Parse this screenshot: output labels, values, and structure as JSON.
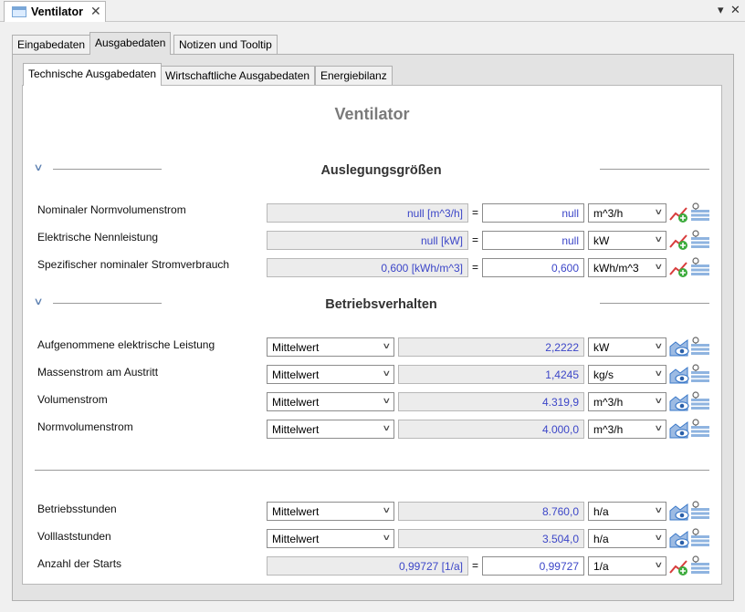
{
  "window": {
    "title": "Ventilator"
  },
  "outer_tabs": [
    {
      "label": "Eingabedaten"
    },
    {
      "label": "Ausgabedaten"
    },
    {
      "label": "Notizen und Tooltip"
    }
  ],
  "inner_tabs": [
    {
      "label": "Technische Ausgabedaten"
    },
    {
      "label": "Wirtschaftliche Ausgabedaten"
    },
    {
      "label": "Energiebilanz"
    }
  ],
  "page_title": "Ventilator",
  "sections": {
    "design": {
      "title": "Auslegungsgrößen",
      "rows": [
        {
          "label": "Nominaler Normvolumenstrom",
          "readonly": "null [m^3/h]",
          "value": "null",
          "unit": "m^3/h"
        },
        {
          "label": "Elektrische Nennleistung",
          "readonly": "null [kW]",
          "value": "null",
          "unit": "kW"
        },
        {
          "label": "Spezifischer nominaler Stromverbrauch",
          "readonly": "0,600 [kWh/m^3]",
          "value": "0,600",
          "unit": "kWh/m^3"
        }
      ]
    },
    "operation": {
      "title": "Betriebsverhalten",
      "rows": [
        {
          "label": "Aufgenommene elektrische Leistung",
          "mode": "Mittelwert",
          "value": "2,2222",
          "unit": "kW"
        },
        {
          "label": "Massenstrom am Austritt",
          "mode": "Mittelwert",
          "value": "1,4245",
          "unit": "kg/s"
        },
        {
          "label": "Volumenstrom",
          "mode": "Mittelwert",
          "value": "4.319,9",
          "unit": "m^3/h"
        },
        {
          "label": "Normvolumenstrom",
          "mode": "Mittelwert",
          "value": "4.000,0",
          "unit": "m^3/h"
        }
      ]
    },
    "hours": {
      "rows": [
        {
          "label": "Betriebsstunden",
          "mode": "Mittelwert",
          "value": "8.760,0",
          "unit": "h/a"
        },
        {
          "label": "Volllaststunden",
          "mode": "Mittelwert",
          "value": "3.504,0",
          "unit": "h/a"
        }
      ],
      "starts": {
        "label": "Anzahl der Starts",
        "readonly": "0,99727 [1/a]",
        "value": "0,99727",
        "unit": "1/a"
      }
    }
  },
  "equals_sign": "=",
  "colors": {
    "value_text": "#3c46c8",
    "chart_red": "#d83c3c",
    "chart_green": "#3cab3c",
    "eye_blue": "#3a78c8"
  }
}
